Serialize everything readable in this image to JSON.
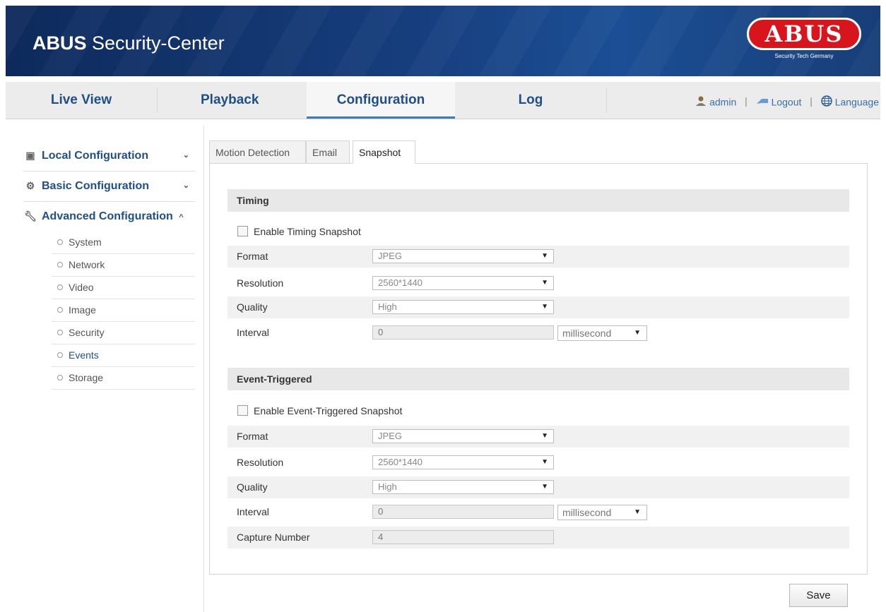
{
  "header": {
    "title_bold": "ABUS",
    "title_rest": " Security-Center",
    "brand_logo": "ABUS",
    "brand_tagline": "Security Tech Germany"
  },
  "nav": {
    "tabs": [
      {
        "label": "Live View"
      },
      {
        "label": "Playback"
      },
      {
        "label": "Configuration",
        "active": true
      },
      {
        "label": "Log"
      }
    ],
    "user": "admin",
    "logout": "Logout",
    "language": "Language",
    "separator": "|",
    "icons": [
      "user-icon",
      "logout-icon",
      "globe-icon"
    ]
  },
  "sidebar": {
    "sections": [
      {
        "label": "Local Configuration",
        "icon": "monitor-icon",
        "chevron": "⌄"
      },
      {
        "label": "Basic Configuration",
        "icon": "gear-icon",
        "chevron": "⌄"
      },
      {
        "label": "Advanced Configuration",
        "icon": "wrench-icon",
        "chevron": "^"
      }
    ],
    "items": [
      "System",
      "Network",
      "Video",
      "Image",
      "Security",
      "Events",
      "Storage"
    ],
    "active_item": "Events"
  },
  "content_tabs": [
    {
      "label": "Motion Detection"
    },
    {
      "label": "Email"
    },
    {
      "label": "Snapshot",
      "active": true
    }
  ],
  "timing": {
    "heading": "Timing",
    "enable_label": "Enable Timing Snapshot",
    "enabled": false,
    "format_label": "Format",
    "format_value": "JPEG",
    "resolution_label": "Resolution",
    "resolution_value": "2560*1440",
    "quality_label": "Quality",
    "quality_value": "High",
    "interval_label": "Interval",
    "interval_value": "0",
    "interval_unit": "millisecond"
  },
  "event": {
    "heading": "Event-Triggered",
    "enable_label": "Enable Event-Triggered Snapshot",
    "enabled": false,
    "format_label": "Format",
    "format_value": "JPEG",
    "resolution_label": "Resolution",
    "resolution_value": "2560*1440",
    "quality_label": "Quality",
    "quality_value": "High",
    "interval_label": "Interval",
    "interval_value": "0",
    "interval_unit": "millisecond",
    "capture_label": "Capture Number",
    "capture_value": "4"
  },
  "dropdown_arrow": "▼",
  "save_label": "Save"
}
